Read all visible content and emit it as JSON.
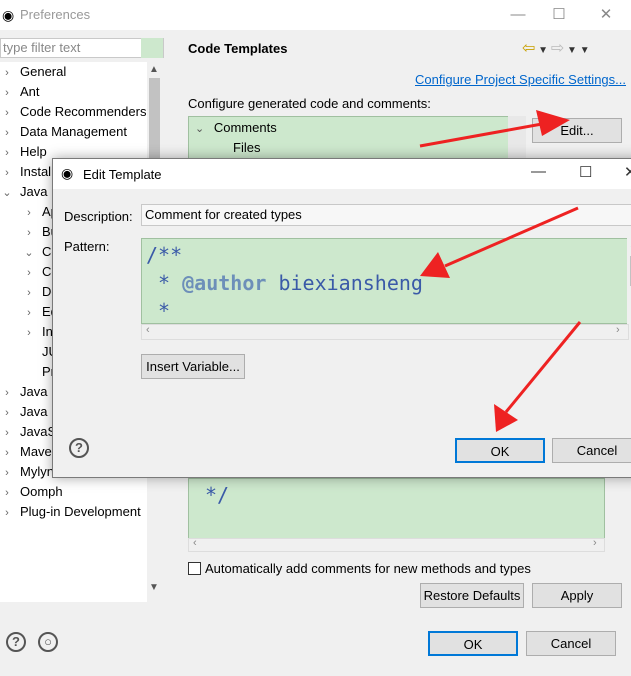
{
  "window": {
    "title": "Preferences"
  },
  "filter": {
    "placeholder": "type filter text"
  },
  "tree": {
    "items": [
      {
        "label": "General",
        "arrow": "›",
        "indent": 0
      },
      {
        "label": "Ant",
        "arrow": "›",
        "indent": 0
      },
      {
        "label": "Code Recommenders",
        "arrow": "›",
        "indent": 0
      },
      {
        "label": "Data Management",
        "arrow": "›",
        "indent": 0
      },
      {
        "label": "Help",
        "arrow": "›",
        "indent": 0
      },
      {
        "label": "Instal",
        "arrow": "›",
        "indent": 0
      },
      {
        "label": "Java",
        "arrow": "⌄",
        "indent": 0
      },
      {
        "label": "Ap",
        "arrow": "›",
        "indent": 1
      },
      {
        "label": "Bu",
        "arrow": "›",
        "indent": 1
      },
      {
        "label": "Co",
        "arrow": "⌄",
        "indent": 1
      },
      {
        "label": "Co",
        "arrow": "›",
        "indent": 1
      },
      {
        "label": "De",
        "arrow": "›",
        "indent": 1
      },
      {
        "label": "Ed",
        "arrow": "›",
        "indent": 1
      },
      {
        "label": "In",
        "arrow": "›",
        "indent": 1
      },
      {
        "label": "JU",
        "arrow": "",
        "indent": 1
      },
      {
        "label": "Pr",
        "arrow": "",
        "indent": 1
      },
      {
        "label": "Java",
        "arrow": "›",
        "indent": 0
      },
      {
        "label": "Java Persistence",
        "arrow": "›",
        "indent": 0
      },
      {
        "label": "JavaScript",
        "arrow": "›",
        "indent": 0
      },
      {
        "label": "Maven",
        "arrow": "›",
        "indent": 0
      },
      {
        "label": "Mylyn",
        "arrow": "›",
        "indent": 0
      },
      {
        "label": "Oomph",
        "arrow": "›",
        "indent": 0
      },
      {
        "label": "Plug-in Development",
        "arrow": "›",
        "indent": 0
      }
    ]
  },
  "page": {
    "title": "Code Templates",
    "configure_link": "Configure Project Specific Settings...",
    "description": "Configure generated code and comments:",
    "templates": {
      "group": "Comments",
      "child": "Files"
    },
    "edit_button": "Edit...",
    "pattern_preview": "*/",
    "auto_comments_label": "Automatically add comments for new methods and types",
    "restore_defaults": "Restore Defaults",
    "apply": "Apply"
  },
  "bottom": {
    "ok": "OK",
    "cancel": "Cancel"
  },
  "dialog": {
    "title": "Edit Template",
    "description_label": "Description:",
    "description_value": "Comment for created types",
    "pattern_label": "Pattern:",
    "pattern_lines": [
      "/**",
      " * @author biexiansheng",
      " *"
    ],
    "author_tag": "@author",
    "author_value": "biexiansheng",
    "insert_variable": "Insert Variable...",
    "ok": "OK",
    "cancel": "Cancel"
  },
  "colors": {
    "accent": "#0078d7",
    "pattern_bg": "#cde8cd",
    "code": "#3a5aa8",
    "annotation_arrow": "#ee2222"
  }
}
